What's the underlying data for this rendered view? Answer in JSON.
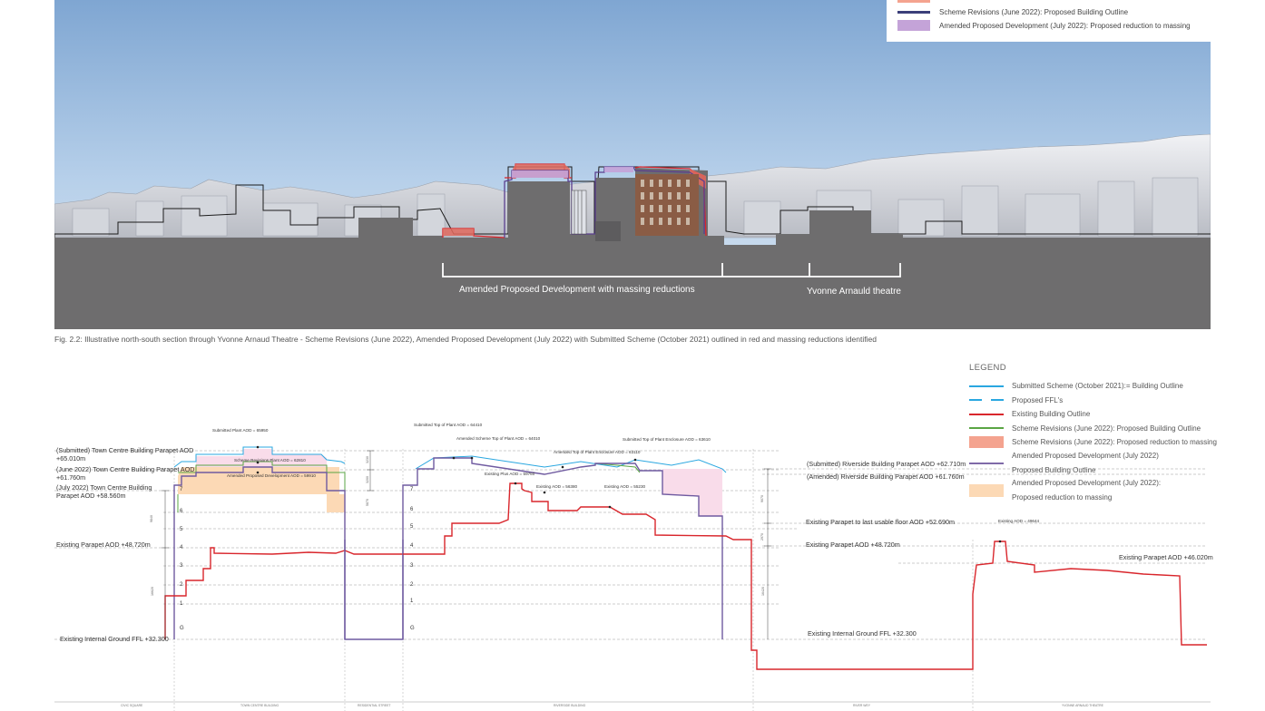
{
  "render": {
    "legend": [
      {
        "label": "Scheme Revisions (June 2022): Proposed Building Outline",
        "color": "#3b3f7a",
        "kind": "line"
      },
      {
        "label": "Amended Proposed Development (July 2022): Proposed reduction to massing",
        "color": "#c4a3d8",
        "kind": "fill"
      }
    ],
    "label_left": "Amended Proposed Development with massing reductions",
    "label_right": "Yvonne Arnauld theatre"
  },
  "caption": "Fig. 2.2: Illustrative north-south section through Yvonne Arnaud Theatre - Scheme Revisions (June 2022), Amended Proposed Development (July 2022) with Submitted Scheme (October 2021) outlined in red and massing reductions identified",
  "legend": {
    "title": "LEGEND",
    "items": [
      {
        "label": "Submitted Scheme (October 2021):= Building Outline",
        "color": "#2aa7e0",
        "kind": "line"
      },
      {
        "label": "Proposed FFL's",
        "color": "#2aa7e0",
        "kind": "dash"
      },
      {
        "label": "Existing Building Outline",
        "color": "#d9262c",
        "kind": "line"
      },
      {
        "label": "Scheme Revisions (June 2022): Proposed Building Outline",
        "color": "#5aa544",
        "kind": "line"
      },
      {
        "label": "Scheme Revisions (June 2022): Proposed reduction to massing",
        "color": "#f4a38f",
        "kind": "fill"
      },
      {
        "label": "Amended Proposed Development (July 2022)",
        "label2": "Proposed Building Outline",
        "color": "#7f6aa8",
        "kind": "line"
      },
      {
        "label": "Amended Proposed Development (July 2022):",
        "label2": "Proposed reduction to massing",
        "color": "#fcd9b5",
        "kind": "fill"
      }
    ]
  },
  "levels_left": {
    "submitted_parapet": "(Submitted) Town Centre Building Parapet AOD",
    "submitted_parapet_val": "+65.010m",
    "june_parapet": "(June 2022) Town Centre Building Parapet AOD",
    "june_parapet_val": "+61.760m",
    "july_parapet": "(July 2022) Town Centre Building",
    "july_parapet_val": "Parapet AOD +58.560m",
    "existing_parapet": "Existing Parapet AOD +48.720m",
    "ground": "Existing Internal Ground FFL +32.300"
  },
  "levels_right": {
    "submitted_riverside": "(Submitted) Riverside Building Parapet AOD +62.710m",
    "amended_riverside": "(Amended) Riverside Building Parapet AOD +61.760m",
    "existing_usable": "Existing Parapet to last usable floor AOD +52.690m",
    "existing_parapet": "Existing Parapet AOD +48.720m",
    "ground": "Existing Internal Ground FFL +32.300",
    "theatre_parapet": "Existing Parapet AOD +46.020m"
  },
  "annotations": {
    "tc_plant": "Submitted Plant AOD = 65950",
    "tc_scheme": "Scheme Revisions Plant AOD = 62810",
    "tc_amended": "Amended Proposed Development AOD = 59910",
    "rv_top_plant": "Submitted Top of Plant AOD = 64410",
    "rv_scheme_plant": "Amended Scheme Top of Plant AOD = 64010",
    "rv_enclosure": "Submitted Top of Plant Enclosure AOD = 63610",
    "rv_plant_enclosure": "Amended Top of Plant Enclosure AOD = 63110",
    "rv_existing_plus": "Existing Plus AOD = 59760",
    "rv_existing_1": "Existing AOD = 56380",
    "rv_existing_2": "Existing AOD = 55230",
    "theatre_existing": "Existing AOD = 49644"
  },
  "floors_tc": [
    "7",
    "6",
    "5",
    "4",
    "3",
    "2",
    "1",
    "G"
  ],
  "floors_rv": [
    "7",
    "6",
    "5",
    "4",
    "3",
    "2",
    "1",
    "G"
  ],
  "dims": {
    "d1": "3230",
    "d2": "3200",
    "d3": "9840",
    "d4": "16620",
    "d5": "5870",
    "d6": "9070",
    "d7": "2970",
    "d8": "16420"
  },
  "zones": [
    "CIVIC SQUARE",
    "TOWN CENTRE BUILDING",
    "RESIDENTIAL STREET",
    "RIVERSIDE BUILDING",
    "RIVER WEY",
    "YVONNE ARNAUD THEATRE"
  ]
}
